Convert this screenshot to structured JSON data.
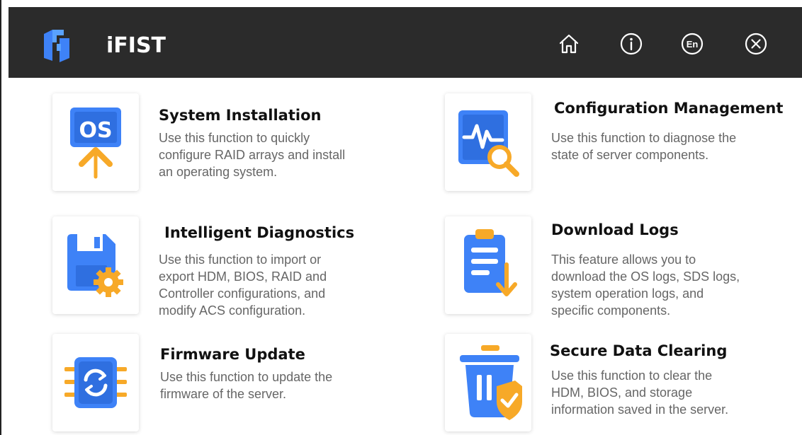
{
  "header": {
    "app_title": "iFIST",
    "icons": [
      "logo-icon",
      "home-icon",
      "info-icon",
      "language-icon",
      "close-icon"
    ],
    "language_label": "En"
  },
  "colors": {
    "topbar": "#2b2b2b",
    "accent_blue": "#3e82f7",
    "accent_orange": "#f7a928"
  },
  "functions": [
    {
      "title": "System Installation",
      "icon": "os-install-icon",
      "icon_text": "OS",
      "description": [
        "Use this function to quickly",
        "configure RAID arrays and install",
        "an operating system."
      ]
    },
    {
      "title": "Configuration Management",
      "icon": "diagnose-monitor-icon",
      "description": [
        "Use this function to diagnose the",
        "state of server components."
      ]
    },
    {
      "title": "Intelligent Diagnostics",
      "icon": "floppy-gear-icon",
      "description": [
        "Use this function to import or",
        "export HDM, BIOS, RAID and",
        "Controller configurations, and",
        "modify ACS configuration."
      ]
    },
    {
      "title": "Download Logs",
      "icon": "clipboard-download-icon",
      "description": [
        "This feature allows you to",
        "download the OS logs, SDS logs,",
        "system operation logs, and",
        "specific components."
      ]
    },
    {
      "title": "Firmware Update",
      "icon": "chip-refresh-icon",
      "description": [
        "Use this function to update the",
        "firmware of the server."
      ]
    },
    {
      "title": "Secure Data Clearing",
      "icon": "trash-shield-icon",
      "description": [
        "Use this function to clear the",
        "HDM, BIOS, and storage",
        "information saved in the server."
      ]
    }
  ]
}
